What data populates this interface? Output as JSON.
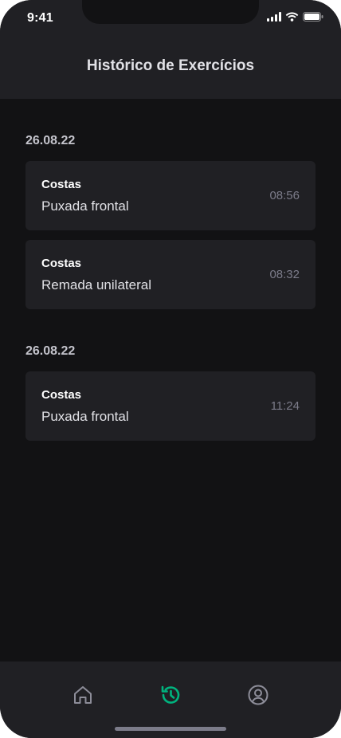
{
  "status_bar": {
    "time": "9:41",
    "icons": [
      "cellular-signal-icon",
      "wifi-icon",
      "battery-icon"
    ]
  },
  "header": {
    "title": "Histórico de Exercícios"
  },
  "history": [
    {
      "date": "26.08.22",
      "items": [
        {
          "group": "Costas",
          "name": "Puxada frontal",
          "time": "08:56"
        },
        {
          "group": "Costas",
          "name": "Remada unilateral",
          "time": "08:32"
        }
      ]
    },
    {
      "date": "26.08.22",
      "items": [
        {
          "group": "Costas",
          "name": "Puxada frontal",
          "time": "11:24"
        }
      ]
    }
  ],
  "tab_bar": {
    "tabs": [
      {
        "icon": "home-icon",
        "active": false
      },
      {
        "icon": "history-icon",
        "active": true
      },
      {
        "icon": "profile-icon",
        "active": false
      }
    ],
    "active_color": "#00B37E",
    "inactive_color": "#8D8D99"
  },
  "colors": {
    "background": "#121214",
    "surface": "#202024",
    "accent": "#00B37E"
  }
}
